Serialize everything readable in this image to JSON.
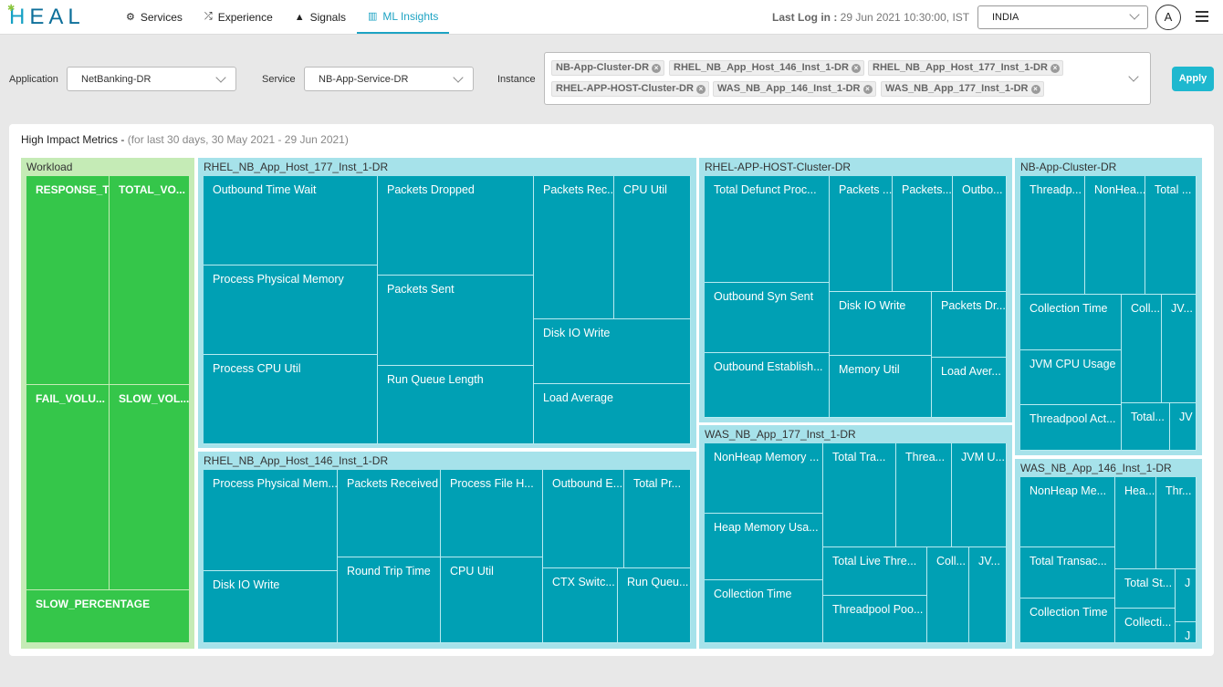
{
  "app": {
    "logo": {
      "prefix": "H",
      "rest": "EAL"
    },
    "nav": [
      {
        "label": "Services",
        "icon": "gears-icon"
      },
      {
        "label": "Experience",
        "icon": "shuffle-icon"
      },
      {
        "label": "Signals",
        "icon": "warning-icon"
      },
      {
        "label": "ML Insights",
        "icon": "bar-chart-icon"
      }
    ],
    "last_login_label": "Last Log in :",
    "last_login_value": "29 Jun 2021 10:30:00, IST",
    "country": "INDIA",
    "avatar": "A"
  },
  "filters": {
    "application_label": "Application",
    "application_value": "NetBanking-DR",
    "service_label": "Service",
    "service_value": "NB-App-Service-DR",
    "instance_label": "Instance",
    "instances": [
      "NB-App-Cluster-DR",
      "RHEL_NB_App_Host_146_Inst_1-DR",
      "RHEL_NB_App_Host_177_Inst_1-DR",
      "RHEL-APP-HOST-Cluster-DR",
      "WAS_NB_App_146_Inst_1-DR",
      "WAS_NB_App_177_Inst_1-DR"
    ],
    "apply_label": "Apply"
  },
  "panel": {
    "title": "High Impact Metrics -",
    "subtitle": "(for last 30 days, 30 May 2021 - 29 Jun 2021)"
  },
  "treemap": {
    "workload": {
      "title": "Workload",
      "cells": [
        "RESPONSE_T...",
        "TOTAL_VO...",
        "FAIL_VOLU...",
        "SLOW_VOL...",
        "SLOW_PERCENTAGE"
      ]
    },
    "host177": {
      "title": "RHEL_NB_App_Host_177_Inst_1-DR",
      "cells": [
        "Outbound Time Wait",
        "Process Physical Memory",
        "Process CPU Util",
        "Packets Dropped",
        "Packets Sent",
        "Run Queue Length",
        "Packets Rec...",
        "CPU Util",
        "Disk IO Write",
        "Load Average"
      ]
    },
    "host146": {
      "title": "RHEL_NB_App_Host_146_Inst_1-DR",
      "cells": [
        "Process Physical Mem...",
        "Disk IO Write",
        "Packets Received",
        "Round Trip Time",
        "Process File H...",
        "CPU Util",
        "Outbound E...",
        "Total Pr...",
        "CTX Switc...",
        "Run Queu..."
      ]
    },
    "cluster": {
      "title": "RHEL-APP-HOST-Cluster-DR",
      "cells": [
        "Total Defunct Proc...",
        "Outbound Syn Sent",
        "Outbound Establish...",
        "Packets ...",
        "Packets...",
        "Outbo...",
        "Disk IO Write",
        "Packets Dr...",
        "Memory Util",
        "Load Aver..."
      ]
    },
    "was177": {
      "title": "WAS_NB_App_177_Inst_1-DR",
      "cells": [
        "NonHeap Memory ...",
        "Heap Memory Usa...",
        "Collection Time",
        "Total Tra...",
        "Threa...",
        "JVM U...",
        "Total Live Thre...",
        "Coll...",
        "JV...",
        "Threadpool Poo..."
      ]
    },
    "nbcluster": {
      "title": "NB-App-Cluster-DR",
      "cells": [
        "Threadp...",
        "NonHea...",
        "Total ...",
        "Collection Time",
        "JVM CPU Usage",
        "Threadpool Act...",
        "Coll...",
        "JV...",
        "Total...",
        "JV"
      ]
    },
    "was146": {
      "title": "WAS_NB_App_146_Inst_1-DR",
      "cells": [
        "NonHeap Me...",
        "Total Transac...",
        "Collection Time",
        "Hea...",
        "Thr...",
        "Total St...",
        "J",
        "Collecti...",
        "J"
      ]
    }
  }
}
